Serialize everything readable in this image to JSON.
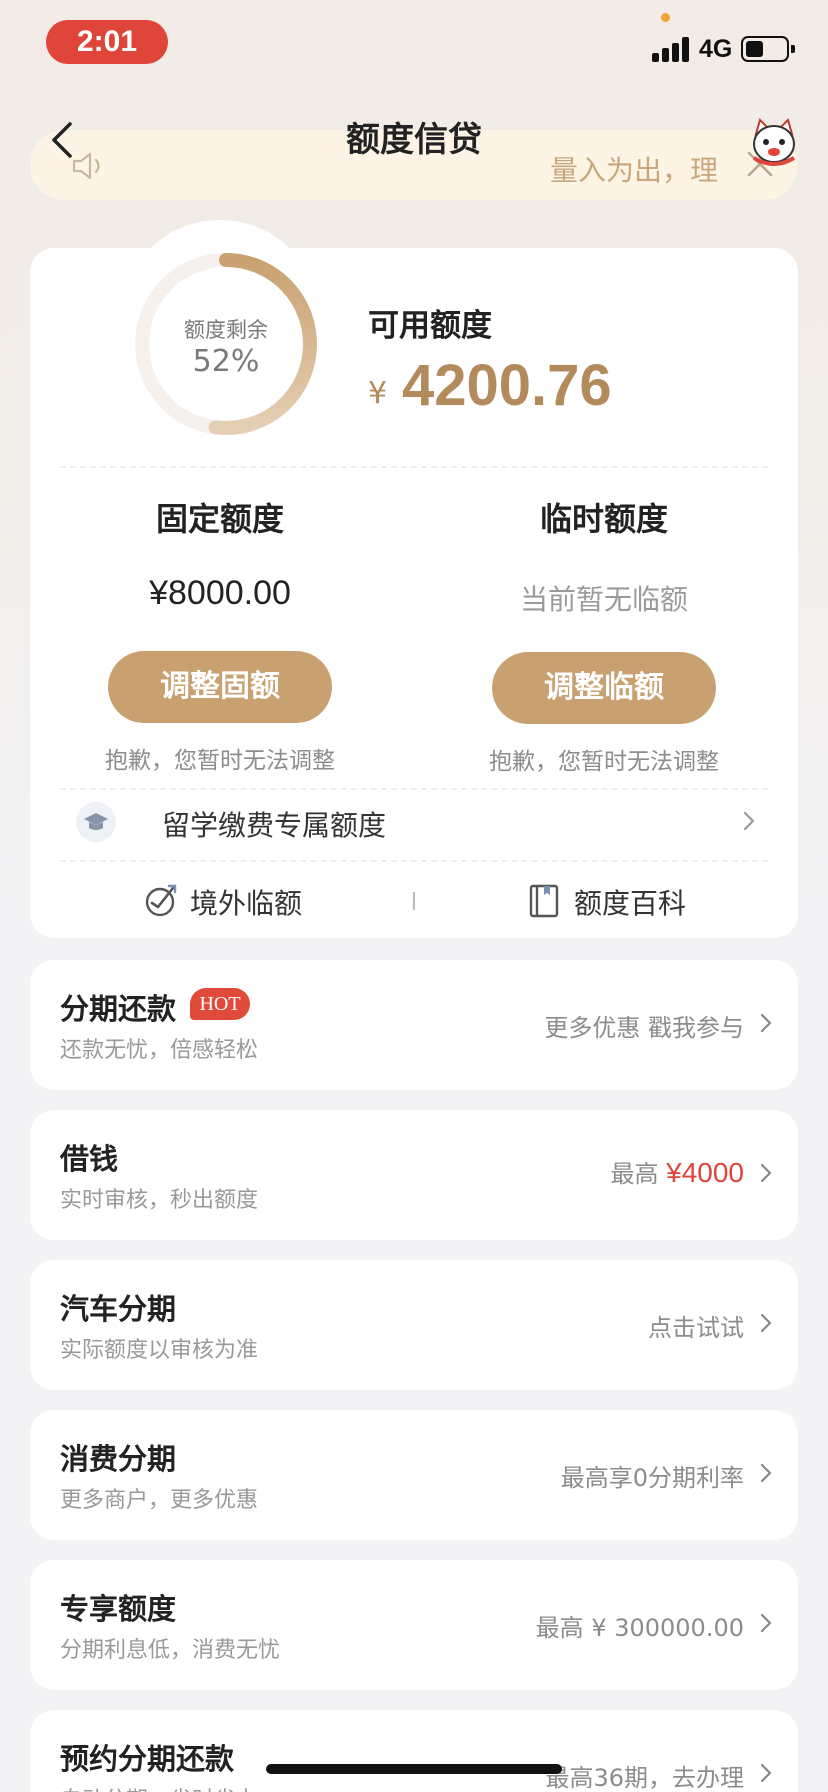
{
  "status_bar": {
    "time": "2:01",
    "network": "4G",
    "battery_percent": 45
  },
  "header": {
    "title": "额度信贷"
  },
  "notice": {
    "text": "量入为出，理"
  },
  "credit": {
    "ring_label": "额度剩余",
    "ring_percent": "52%",
    "ring_fraction": 0.52,
    "available_label": "可用额度",
    "currency": "¥",
    "available_amount": "4200.76"
  },
  "fixed": {
    "title": "固定额度",
    "amount": "¥8000.00",
    "button": "调整固额",
    "note": "抱歉，您暂时无法调整"
  },
  "temp": {
    "title": "临时额度",
    "amount": "当前暂无临额",
    "button": "调整临额",
    "note": "抱歉，您暂时无法调整"
  },
  "study": {
    "label": "留学缴费专属额度"
  },
  "links": [
    {
      "label": "境外临额"
    },
    {
      "label": "额度百科"
    }
  ],
  "products": [
    {
      "title": "分期还款",
      "badge": "HOT",
      "subtitle": "还款无忧，倍感轻松",
      "right": "更多优惠 戳我参与"
    },
    {
      "title": "借钱",
      "subtitle": "实时审核，秒出额度",
      "right_prefix": "最高",
      "right_highlight": "¥4000"
    },
    {
      "title": "汽车分期",
      "subtitle": "实际额度以审核为准",
      "right": "点击试试"
    },
    {
      "title": "消费分期",
      "subtitle": "更多商户，更多优惠",
      "right": "最高享0分期利率"
    },
    {
      "title": "专享额度",
      "subtitle": "分期利息低，消费无忧",
      "right": "最高 ¥ 300000.00"
    },
    {
      "title": "预约分期还款",
      "subtitle": "自动分期，省时省力",
      "right": "最高36期，去办理"
    }
  ]
}
